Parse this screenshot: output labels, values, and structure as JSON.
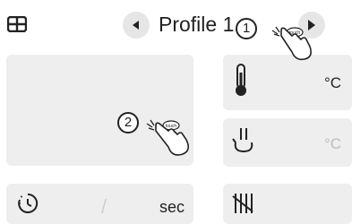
{
  "header": {
    "title": "Profile 1",
    "menu_icon": "grid-menu-icon",
    "prev_icon": "triangle-left-icon",
    "next_icon": "triangle-right-icon"
  },
  "cards": {
    "temperature_unit": "°C",
    "steam_unit": "°C",
    "timer_separator": "/",
    "timer_unit": "sec"
  },
  "annotations": {
    "step1_label": "1",
    "step2_label": "2",
    "touch_label": "touch"
  },
  "colors": {
    "card_bg": "#eeeeee",
    "button_bg": "#e6e6e6",
    "icon": "#222222",
    "muted_unit": "#bdbdbd"
  }
}
